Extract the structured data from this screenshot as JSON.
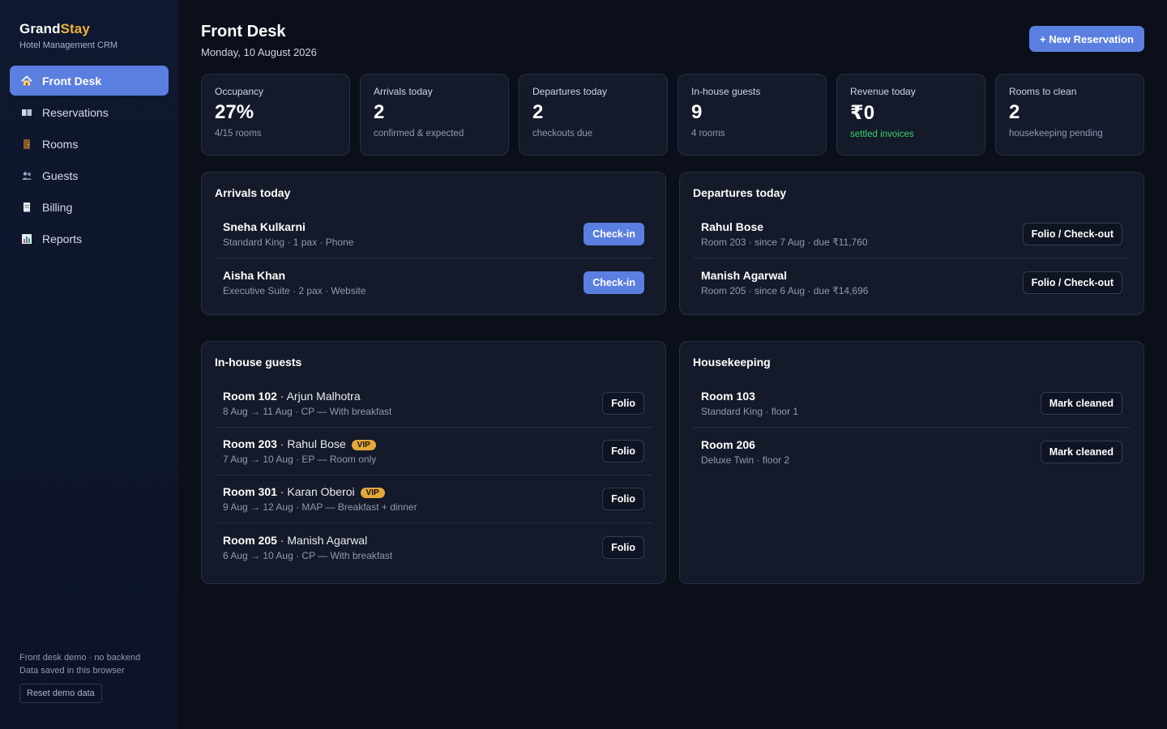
{
  "brand": {
    "name_part1": "Grand",
    "name_part2": "Stay",
    "subtitle": "Hotel Management CRM"
  },
  "sidebar": {
    "items": [
      {
        "label": "Front Desk",
        "icon": "home-icon",
        "active": true
      },
      {
        "label": "Reservations",
        "icon": "book-icon"
      },
      {
        "label": "Rooms",
        "icon": "door-icon"
      },
      {
        "label": "Guests",
        "icon": "people-icon"
      },
      {
        "label": "Billing",
        "icon": "receipt-icon"
      },
      {
        "label": "Reports",
        "icon": "bar-chart-icon"
      }
    ],
    "footer_line1": "Front desk demo · no backend",
    "footer_line2": "Data saved in this browser",
    "reset_label": "Reset demo data"
  },
  "header": {
    "title": "Front Desk",
    "date": "Monday, 10 August 2026",
    "new_reservation_label": "+ New Reservation"
  },
  "stats": [
    {
      "label": "Occupancy",
      "value": "27%",
      "sub": "4/15 rooms"
    },
    {
      "label": "Arrivals today",
      "value": "2",
      "sub": "confirmed & expected"
    },
    {
      "label": "Departures today",
      "value": "2",
      "sub": "checkouts due"
    },
    {
      "label": "In-house guests",
      "value": "9",
      "sub": "4 rooms"
    },
    {
      "label": "Revenue today",
      "value": "₹0",
      "sub": "settled invoices",
      "sub_color": "#3ccf72"
    },
    {
      "label": "Rooms to clean",
      "value": "2",
      "sub": "housekeeping pending"
    }
  ],
  "arrivals": {
    "title": "Arrivals today",
    "items": [
      {
        "name": "Sneha Kulkarni",
        "detail": "Standard King · 1 pax · Phone",
        "action": "Check-in"
      },
      {
        "name": "Aisha Khan",
        "detail": "Executive Suite · 2 pax · Website",
        "action": "Check-in"
      }
    ]
  },
  "departures": {
    "title": "Departures today",
    "items": [
      {
        "name": "Rahul Bose",
        "detail": "Room 203 · since 7 Aug · due ₹11,760",
        "action": "Folio / Check-out"
      },
      {
        "name": "Manish Agarwal",
        "detail": "Room 205 · since 6 Aug · due ₹14,696",
        "action": "Folio / Check-out"
      }
    ]
  },
  "inhouse": {
    "title": "In-house guests",
    "items": [
      {
        "room": "Room 102",
        "sep": " · ",
        "guest": "Arjun Malhotra",
        "badge": "",
        "detail": "8 Aug → 11 Aug · CP — With breakfast",
        "action": "Folio"
      },
      {
        "room": "Room 203",
        "sep": " · ",
        "guest": "Rahul Bose",
        "badge": "VIP",
        "detail": "7 Aug → 10 Aug · EP — Room only",
        "action": "Folio"
      },
      {
        "room": "Room 301",
        "sep": " · ",
        "guest": "Karan Oberoi",
        "badge": "VIP",
        "detail": "9 Aug → 12 Aug · MAP — Breakfast + dinner",
        "action": "Folio"
      },
      {
        "room": "Room 205",
        "sep": " · ",
        "guest": "Manish Agarwal",
        "badge": "",
        "detail": "6 Aug → 10 Aug · CP — With breakfast",
        "action": "Folio"
      }
    ]
  },
  "housekeeping": {
    "title": "Housekeeping",
    "items": [
      {
        "room": "Room 103",
        "detail": "Standard King · floor 1",
        "action": "Mark cleaned"
      },
      {
        "room": "Room 206",
        "detail": "Deluxe Twin · floor 2",
        "action": "Mark cleaned"
      }
    ]
  },
  "colors": {
    "accent": "#5b7fe0",
    "brand_accent": "#f0b23c",
    "success": "#3ccf72",
    "vip": "#e3a83a"
  }
}
